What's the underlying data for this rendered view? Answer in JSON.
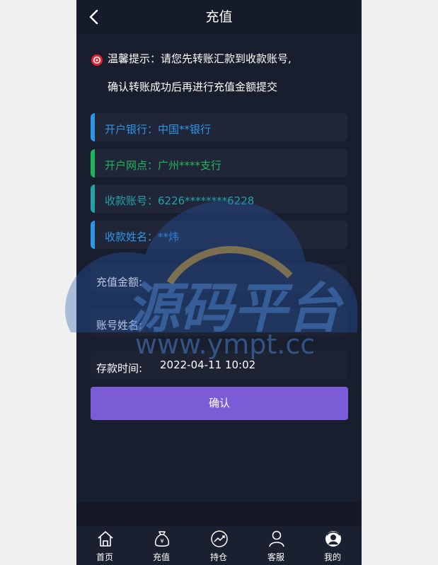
{
  "header": {
    "title": "充值"
  },
  "notice": {
    "line1": "温馨提示：请您先转账汇款到收款账号,",
    "line2": "确认转账成功后再进行充值金额提交"
  },
  "info": [
    {
      "text": "开户银行：中国**银行",
      "color": "#2c97e8"
    },
    {
      "text": "开户网点：广州****支行",
      "color": "#1fb65a"
    },
    {
      "text": "收款账号：6226********6228",
      "color": "#22a3a8"
    },
    {
      "text": "收款姓名：**炜",
      "color": "#2c97e8"
    }
  ],
  "form": {
    "amount_label": "充值金额:",
    "name_label": "账号姓名:",
    "time_label": "存款时间:",
    "time_value": "2022-04-11 10:02"
  },
  "confirm_label": "确认",
  "watermark": {
    "title": "源码平台",
    "url": "www.ympt.cc"
  },
  "tabs": [
    {
      "label": "首页",
      "icon": "home-icon"
    },
    {
      "label": "充值",
      "icon": "money-bag-icon"
    },
    {
      "label": "持仓",
      "icon": "trend-chart-icon"
    },
    {
      "label": "客服",
      "icon": "user-icon"
    },
    {
      "label": "我的",
      "icon": "avatar-icon"
    }
  ],
  "colors": {
    "accent": "#7b5cd6",
    "background": "#181e2e",
    "notice_icon": "#e8212e"
  }
}
